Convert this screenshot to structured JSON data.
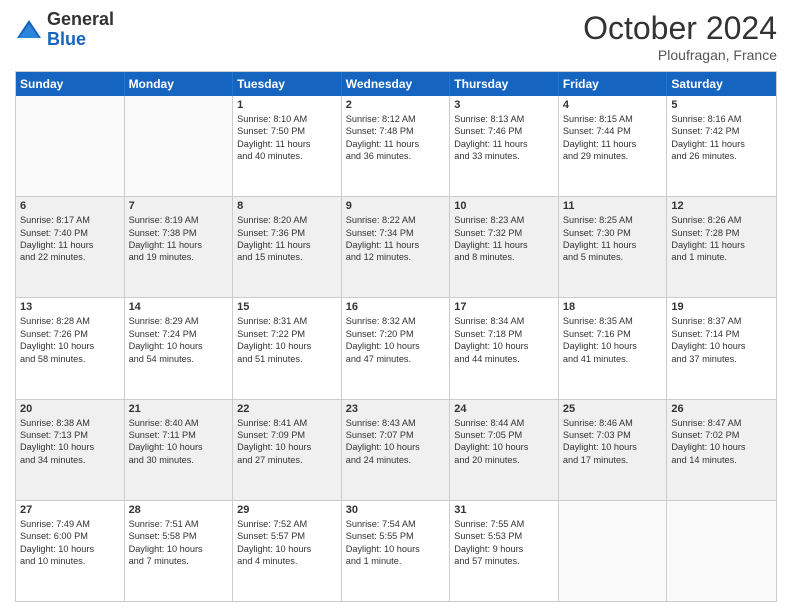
{
  "header": {
    "logo_general": "General",
    "logo_blue": "Blue",
    "title": "October 2024",
    "location": "Ploufragan, France"
  },
  "days_of_week": [
    "Sunday",
    "Monday",
    "Tuesday",
    "Wednesday",
    "Thursday",
    "Friday",
    "Saturday"
  ],
  "rows": [
    [
      {
        "day": "",
        "lines": [],
        "empty": true
      },
      {
        "day": "",
        "lines": [],
        "empty": true
      },
      {
        "day": "1",
        "lines": [
          "Sunrise: 8:10 AM",
          "Sunset: 7:50 PM",
          "Daylight: 11 hours",
          "and 40 minutes."
        ]
      },
      {
        "day": "2",
        "lines": [
          "Sunrise: 8:12 AM",
          "Sunset: 7:48 PM",
          "Daylight: 11 hours",
          "and 36 minutes."
        ]
      },
      {
        "day": "3",
        "lines": [
          "Sunrise: 8:13 AM",
          "Sunset: 7:46 PM",
          "Daylight: 11 hours",
          "and 33 minutes."
        ]
      },
      {
        "day": "4",
        "lines": [
          "Sunrise: 8:15 AM",
          "Sunset: 7:44 PM",
          "Daylight: 11 hours",
          "and 29 minutes."
        ]
      },
      {
        "day": "5",
        "lines": [
          "Sunrise: 8:16 AM",
          "Sunset: 7:42 PM",
          "Daylight: 11 hours",
          "and 26 minutes."
        ]
      }
    ],
    [
      {
        "day": "6",
        "lines": [
          "Sunrise: 8:17 AM",
          "Sunset: 7:40 PM",
          "Daylight: 11 hours",
          "and 22 minutes."
        ]
      },
      {
        "day": "7",
        "lines": [
          "Sunrise: 8:19 AM",
          "Sunset: 7:38 PM",
          "Daylight: 11 hours",
          "and 19 minutes."
        ]
      },
      {
        "day": "8",
        "lines": [
          "Sunrise: 8:20 AM",
          "Sunset: 7:36 PM",
          "Daylight: 11 hours",
          "and 15 minutes."
        ]
      },
      {
        "day": "9",
        "lines": [
          "Sunrise: 8:22 AM",
          "Sunset: 7:34 PM",
          "Daylight: 11 hours",
          "and 12 minutes."
        ]
      },
      {
        "day": "10",
        "lines": [
          "Sunrise: 8:23 AM",
          "Sunset: 7:32 PM",
          "Daylight: 11 hours",
          "and 8 minutes."
        ]
      },
      {
        "day": "11",
        "lines": [
          "Sunrise: 8:25 AM",
          "Sunset: 7:30 PM",
          "Daylight: 11 hours",
          "and 5 minutes."
        ]
      },
      {
        "day": "12",
        "lines": [
          "Sunrise: 8:26 AM",
          "Sunset: 7:28 PM",
          "Daylight: 11 hours",
          "and 1 minute."
        ]
      }
    ],
    [
      {
        "day": "13",
        "lines": [
          "Sunrise: 8:28 AM",
          "Sunset: 7:26 PM",
          "Daylight: 10 hours",
          "and 58 minutes."
        ]
      },
      {
        "day": "14",
        "lines": [
          "Sunrise: 8:29 AM",
          "Sunset: 7:24 PM",
          "Daylight: 10 hours",
          "and 54 minutes."
        ]
      },
      {
        "day": "15",
        "lines": [
          "Sunrise: 8:31 AM",
          "Sunset: 7:22 PM",
          "Daylight: 10 hours",
          "and 51 minutes."
        ]
      },
      {
        "day": "16",
        "lines": [
          "Sunrise: 8:32 AM",
          "Sunset: 7:20 PM",
          "Daylight: 10 hours",
          "and 47 minutes."
        ]
      },
      {
        "day": "17",
        "lines": [
          "Sunrise: 8:34 AM",
          "Sunset: 7:18 PM",
          "Daylight: 10 hours",
          "and 44 minutes."
        ]
      },
      {
        "day": "18",
        "lines": [
          "Sunrise: 8:35 AM",
          "Sunset: 7:16 PM",
          "Daylight: 10 hours",
          "and 41 minutes."
        ]
      },
      {
        "day": "19",
        "lines": [
          "Sunrise: 8:37 AM",
          "Sunset: 7:14 PM",
          "Daylight: 10 hours",
          "and 37 minutes."
        ]
      }
    ],
    [
      {
        "day": "20",
        "lines": [
          "Sunrise: 8:38 AM",
          "Sunset: 7:13 PM",
          "Daylight: 10 hours",
          "and 34 minutes."
        ]
      },
      {
        "day": "21",
        "lines": [
          "Sunrise: 8:40 AM",
          "Sunset: 7:11 PM",
          "Daylight: 10 hours",
          "and 30 minutes."
        ]
      },
      {
        "day": "22",
        "lines": [
          "Sunrise: 8:41 AM",
          "Sunset: 7:09 PM",
          "Daylight: 10 hours",
          "and 27 minutes."
        ]
      },
      {
        "day": "23",
        "lines": [
          "Sunrise: 8:43 AM",
          "Sunset: 7:07 PM",
          "Daylight: 10 hours",
          "and 24 minutes."
        ]
      },
      {
        "day": "24",
        "lines": [
          "Sunrise: 8:44 AM",
          "Sunset: 7:05 PM",
          "Daylight: 10 hours",
          "and 20 minutes."
        ]
      },
      {
        "day": "25",
        "lines": [
          "Sunrise: 8:46 AM",
          "Sunset: 7:03 PM",
          "Daylight: 10 hours",
          "and 17 minutes."
        ]
      },
      {
        "day": "26",
        "lines": [
          "Sunrise: 8:47 AM",
          "Sunset: 7:02 PM",
          "Daylight: 10 hours",
          "and 14 minutes."
        ]
      }
    ],
    [
      {
        "day": "27",
        "lines": [
          "Sunrise: 7:49 AM",
          "Sunset: 6:00 PM",
          "Daylight: 10 hours",
          "and 10 minutes."
        ]
      },
      {
        "day": "28",
        "lines": [
          "Sunrise: 7:51 AM",
          "Sunset: 5:58 PM",
          "Daylight: 10 hours",
          "and 7 minutes."
        ]
      },
      {
        "day": "29",
        "lines": [
          "Sunrise: 7:52 AM",
          "Sunset: 5:57 PM",
          "Daylight: 10 hours",
          "and 4 minutes."
        ]
      },
      {
        "day": "30",
        "lines": [
          "Sunrise: 7:54 AM",
          "Sunset: 5:55 PM",
          "Daylight: 10 hours",
          "and 1 minute."
        ]
      },
      {
        "day": "31",
        "lines": [
          "Sunrise: 7:55 AM",
          "Sunset: 5:53 PM",
          "Daylight: 9 hours",
          "and 57 minutes."
        ]
      },
      {
        "day": "",
        "lines": [],
        "empty": true
      },
      {
        "day": "",
        "lines": [],
        "empty": true
      }
    ]
  ]
}
